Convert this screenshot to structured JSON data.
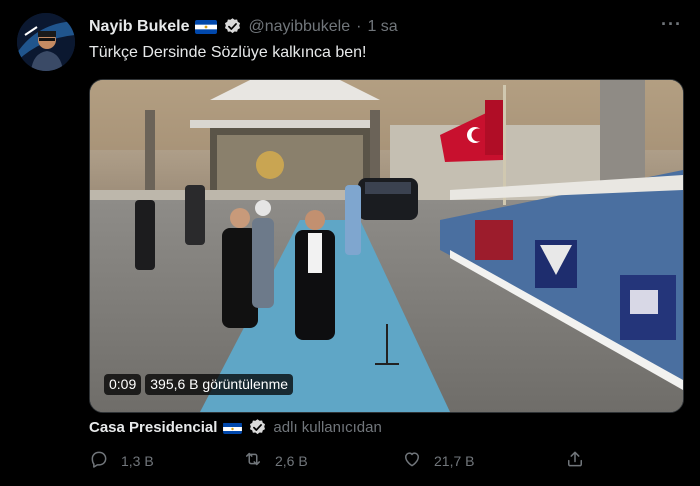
{
  "tweet": {
    "display_name": "Nayib Bukele",
    "handle": "@nayibbukele",
    "separator": "·",
    "time": "1 sa",
    "text": "Türkçe Dersinde Sözlüye kalkınca ben!",
    "more_label": "···"
  },
  "media": {
    "duration": "0:09",
    "views": "395,6 B görüntülenme"
  },
  "source": {
    "name": "Casa Presidencial",
    "suffix": "adlı kullanıcıdan"
  },
  "actions": {
    "reply_count": "1,3 B",
    "retweet_count": "2,6 B",
    "like_count": "21,7 B"
  },
  "colors": {
    "background": "#000000",
    "primary_text": "#e7e9ea",
    "secondary_text": "#71767b",
    "verified": "#d9d9d9",
    "flag_blue": "#0047ab"
  }
}
